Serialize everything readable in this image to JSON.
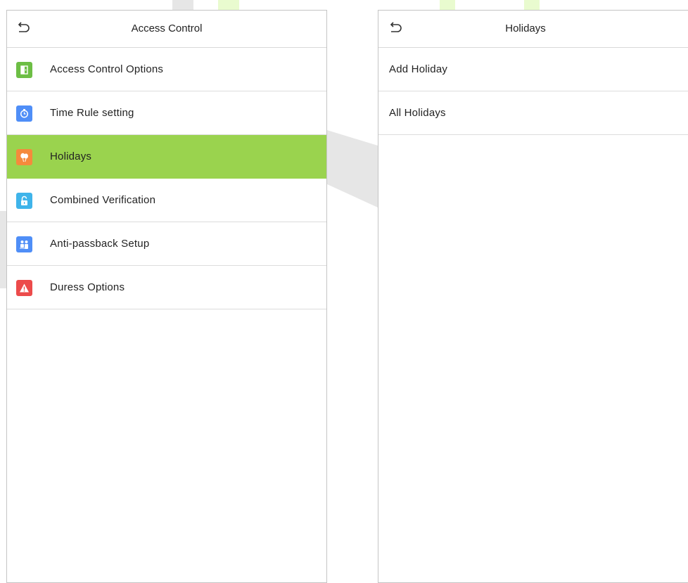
{
  "left_panel": {
    "title": "Access Control",
    "items": [
      {
        "label": "Access Control Options",
        "icon": "door-icon",
        "color": "#6dbe45"
      },
      {
        "label": "Time Rule setting",
        "icon": "clock-icon",
        "color": "#4f8ef7"
      },
      {
        "label": "Holidays",
        "icon": "balloons-icon",
        "color": "#f58a3c",
        "selected": true
      },
      {
        "label": "Combined Verification",
        "icon": "unlock-icon",
        "color": "#3fb4ea"
      },
      {
        "label": "Anti-passback Setup",
        "icon": "people-icon",
        "color": "#4f8ef7"
      },
      {
        "label": "Duress Options",
        "icon": "warning-icon",
        "color": "#ec4b4b"
      }
    ]
  },
  "right_panel": {
    "title": "Holidays",
    "items": [
      {
        "label": "Add Holiday"
      },
      {
        "label": "All Holidays"
      }
    ]
  },
  "colors": {
    "selected_row": "#9ad34e",
    "border": "#c4c4c4",
    "divider": "#dcdcdc"
  }
}
